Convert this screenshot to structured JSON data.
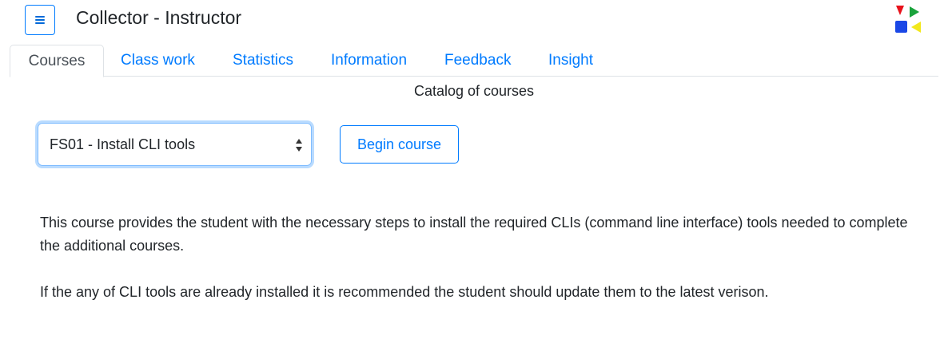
{
  "header": {
    "title": "Collector - Instructor",
    "menu_icon": "hamburger-menu-icon",
    "logo_icon": "collector-logo-icon",
    "logo_colors": {
      "red": "#e8121b",
      "green": "#1aa33c",
      "blue": "#1a47e6",
      "yellow": "#f2e81c"
    }
  },
  "tabs": [
    {
      "label": "Courses",
      "active": true
    },
    {
      "label": "Class work",
      "active": false
    },
    {
      "label": "Statistics",
      "active": false
    },
    {
      "label": "Information",
      "active": false
    },
    {
      "label": "Feedback",
      "active": false
    },
    {
      "label": "Insight",
      "active": false
    }
  ],
  "catalog": {
    "title": "Catalog of courses",
    "selected_course": "FS01 - Install CLI tools",
    "begin_label": "Begin course"
  },
  "description": {
    "paragraph_1": "This course provides the student with the necessary steps to install the required CLIs (command line interface) tools needed to complete the additional courses.",
    "paragraph_2": "If the any of CLI tools are already installed it is recommended the student should update them to the latest verison."
  },
  "colors": {
    "accent": "#007bff",
    "text": "#212529",
    "tab_border": "#dee2e6"
  }
}
